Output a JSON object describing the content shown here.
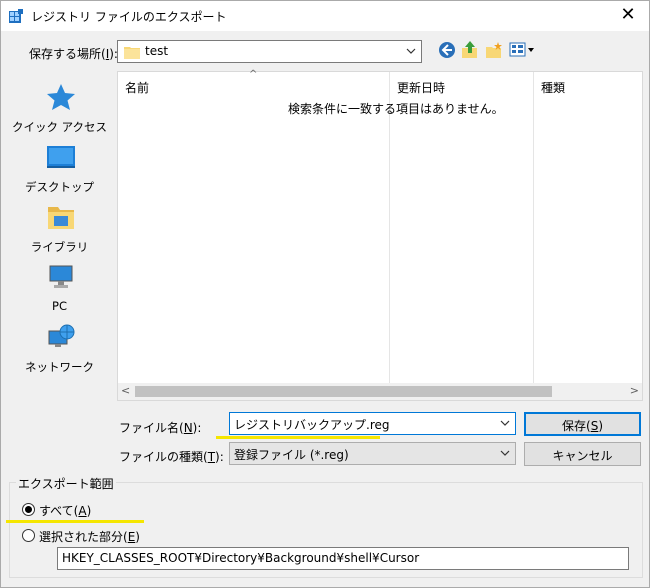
{
  "window": {
    "title": "レジストリ ファイルのエクスポート",
    "close_glyph": "✕"
  },
  "location": {
    "label": "保存する場所(I):",
    "value": "test"
  },
  "toolbar": {
    "back_icon": "back-arrow-icon",
    "up_icon": "up-folder-icon",
    "new_folder_icon": "new-folder-icon",
    "view_icon": "view-menu-icon"
  },
  "places": [
    {
      "label": "クイック アクセス",
      "icon": "star-icon"
    },
    {
      "label": "デスクトップ",
      "icon": "desktop-icon"
    },
    {
      "label": "ライブラリ",
      "icon": "library-icon"
    },
    {
      "label": "PC",
      "icon": "pc-icon"
    },
    {
      "label": "ネットワーク",
      "icon": "network-icon"
    }
  ],
  "filelist": {
    "columns": [
      "名前",
      "更新日時",
      "種類"
    ],
    "sort_glyph": "^",
    "empty_message": "検索条件に一致する項目はありません。"
  },
  "filename": {
    "label": "ファイル名(N):",
    "value": "レジストリバックアップ.reg"
  },
  "filetype": {
    "label": "ファイルの種類(T):",
    "value": "登録ファイル (*.reg)"
  },
  "buttons": {
    "save": "保存(S)",
    "cancel": "キャンセル"
  },
  "export_range": {
    "title": "エクスポート範囲",
    "all_label": "すべて(A)",
    "selected_label": "選択された部分(E)",
    "selected_value": "HKEY_CLASSES_ROOT¥Directory¥Background¥shell¥Cursor",
    "selected_option": "all"
  },
  "colors": {
    "accent": "#0078d7",
    "highlight": "#f5e600",
    "folder": "#f8d775"
  }
}
